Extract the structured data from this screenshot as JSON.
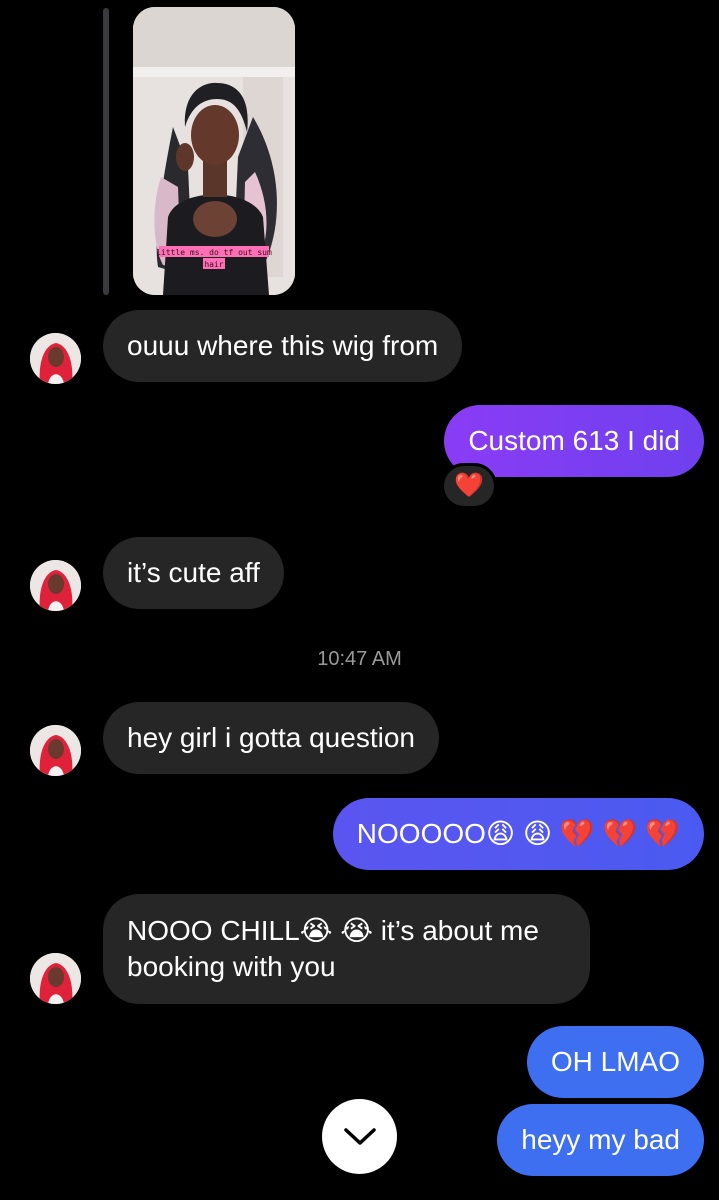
{
  "story_reply": {
    "caption_line1": "little ms. do tf out sum",
    "caption_line2": "hair"
  },
  "messages": [
    {
      "text": "ouuu where this wig from"
    },
    {
      "text": "Custom 613 I did",
      "reaction_icon": "heart-emoji-icon",
      "reaction": "❤️"
    },
    {
      "text": "it’s cute aff"
    },
    {
      "text": "hey girl i gotta question"
    },
    {
      "text": "NOOOOO😩 😩 💔 💔 💔"
    },
    {
      "text": "NOOO CHILL😭 😭 it’s about me booking with you"
    },
    {
      "text": "OH LMAO"
    },
    {
      "text": "heyy my bad"
    }
  ],
  "timestamp": "10:47 AM",
  "colors": {
    "background": "#000000",
    "incoming_bubble": "#262626",
    "outgoing_purple": "#7b3ff2",
    "outgoing_indigo": "#5357f0",
    "outgoing_blue": "#3d6ff0",
    "timestamp_text": "#9a9a9a"
  },
  "icons": {
    "scroll_down": "chevron-down-icon"
  }
}
